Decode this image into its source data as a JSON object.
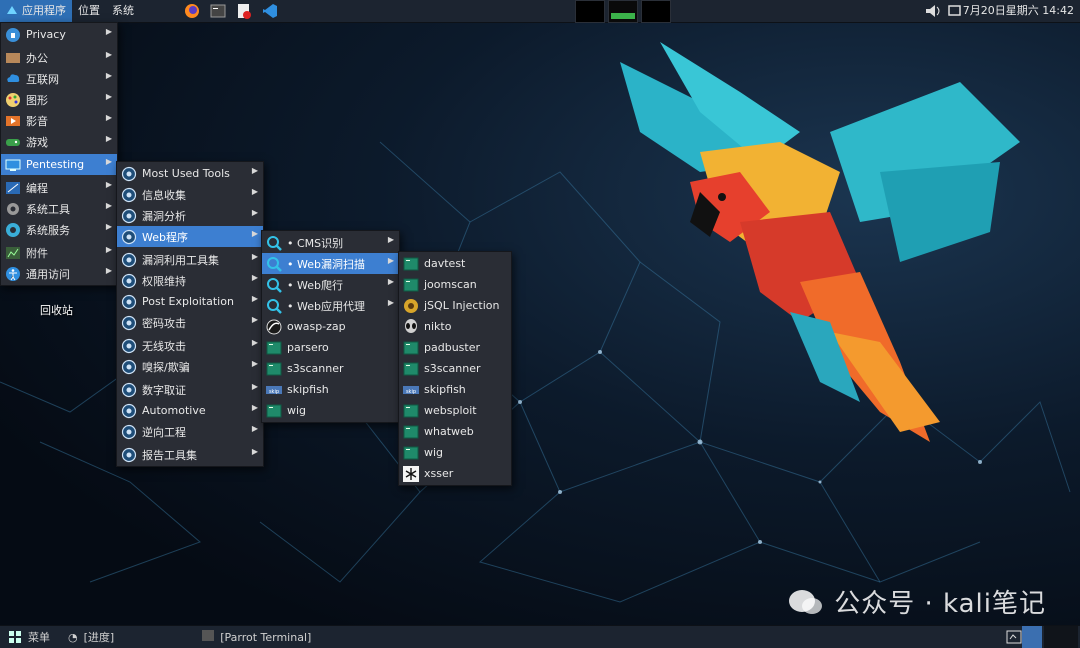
{
  "top_panel": {
    "menus": [
      "应用程序",
      "位置",
      "系统"
    ],
    "launchers": [
      "firefox-icon",
      "terminal-icon",
      "pdf-icon",
      "vscode-icon"
    ],
    "clock": "7月20日星期六 14:42"
  },
  "desktop": {
    "trash_label": "回收站",
    "watermark": "公众号 · kali笔记"
  },
  "menu_level1": [
    {
      "label": "Privacy",
      "icon": "privacy-icon",
      "arrow": true
    },
    {
      "label": "办公",
      "icon": "office-icon",
      "arrow": true
    },
    {
      "label": "互联网",
      "icon": "internet-icon",
      "arrow": true
    },
    {
      "label": "图形",
      "icon": "graphics-icon",
      "arrow": true
    },
    {
      "label": "影音",
      "icon": "multimedia-icon",
      "arrow": true
    },
    {
      "label": "游戏",
      "icon": "games-icon",
      "arrow": true
    },
    {
      "label": "Pentesting",
      "icon": "pentesting-icon",
      "arrow": true,
      "selected": true
    },
    {
      "label": "编程",
      "icon": "programming-icon",
      "arrow": true
    },
    {
      "label": "系统工具",
      "icon": "system-tools-icon",
      "arrow": true
    },
    {
      "label": "系统服务",
      "icon": "system-services-icon",
      "arrow": true
    },
    {
      "label": "附件",
      "icon": "accessories-icon",
      "arrow": true
    },
    {
      "label": "通用访问",
      "icon": "accessibility-icon",
      "arrow": true
    }
  ],
  "menu_level2": [
    {
      "label": "Most Used Tools",
      "icon": "most-used-icon"
    },
    {
      "label": "信息收集",
      "icon": "info-gathering-icon"
    },
    {
      "label": "漏洞分析",
      "icon": "vuln-analysis-icon"
    },
    {
      "label": "Web程序",
      "icon": "web-apps-icon",
      "selected": true
    },
    {
      "label": "漏洞利用工具集",
      "icon": "exploitation-icon"
    },
    {
      "label": "权限维持",
      "icon": "maintaining-access-icon"
    },
    {
      "label": "Post Exploitation",
      "icon": "post-exploitation-icon"
    },
    {
      "label": "密码攻击",
      "icon": "password-attacks-icon"
    },
    {
      "label": "无线攻击",
      "icon": "wireless-attacks-icon"
    },
    {
      "label": "嗅探/欺骗",
      "icon": "sniffing-spoofing-icon"
    },
    {
      "label": "数字取证",
      "icon": "forensics-icon"
    },
    {
      "label": "Automotive",
      "icon": "automotive-icon"
    },
    {
      "label": "逆向工程",
      "icon": "reverse-engineering-icon"
    },
    {
      "label": "报告工具集",
      "icon": "reporting-icon"
    }
  ],
  "menu_level3": [
    {
      "label": "• CMS识别",
      "icon": "cms-icon",
      "arrow": true
    },
    {
      "label": "• Web漏洞扫描",
      "icon": "web-scanner-icon",
      "arrow": true,
      "selected": true
    },
    {
      "label": "• Web爬行",
      "icon": "web-crawler-icon",
      "arrow": true
    },
    {
      "label": "• Web应用代理",
      "icon": "web-proxy-icon",
      "arrow": true
    },
    {
      "label": "owasp-zap",
      "icon": "owasp-zap-icon"
    },
    {
      "label": "parsero",
      "icon": "terminal-icon"
    },
    {
      "label": "s3scanner",
      "icon": "terminal-icon"
    },
    {
      "label": "skipfish",
      "icon": "skipfish-icon"
    },
    {
      "label": "wig",
      "icon": "terminal-icon"
    }
  ],
  "menu_level4": [
    {
      "label": "davtest",
      "icon": "terminal-icon"
    },
    {
      "label": "joomscan",
      "icon": "terminal-icon"
    },
    {
      "label": "jSQL Injection",
      "icon": "jsql-icon"
    },
    {
      "label": "nikto",
      "icon": "nikto-alien-icon"
    },
    {
      "label": "padbuster",
      "icon": "terminal-icon"
    },
    {
      "label": "s3scanner",
      "icon": "terminal-icon"
    },
    {
      "label": "skipfish",
      "icon": "skipfish-icon"
    },
    {
      "label": "websploit",
      "icon": "terminal-icon"
    },
    {
      "label": "whatweb",
      "icon": "terminal-icon"
    },
    {
      "label": "wig",
      "icon": "terminal-icon"
    },
    {
      "label": "xsser",
      "icon": "xsser-icon"
    }
  ],
  "bottom_panel": {
    "menu_label": "菜单",
    "tasks": [
      "[进度]",
      "[Parrot Terminal]"
    ]
  },
  "colors": {
    "selection": "#3d7fd1",
    "panel": "#1c2430",
    "menu_bg": "#2a2d35"
  }
}
